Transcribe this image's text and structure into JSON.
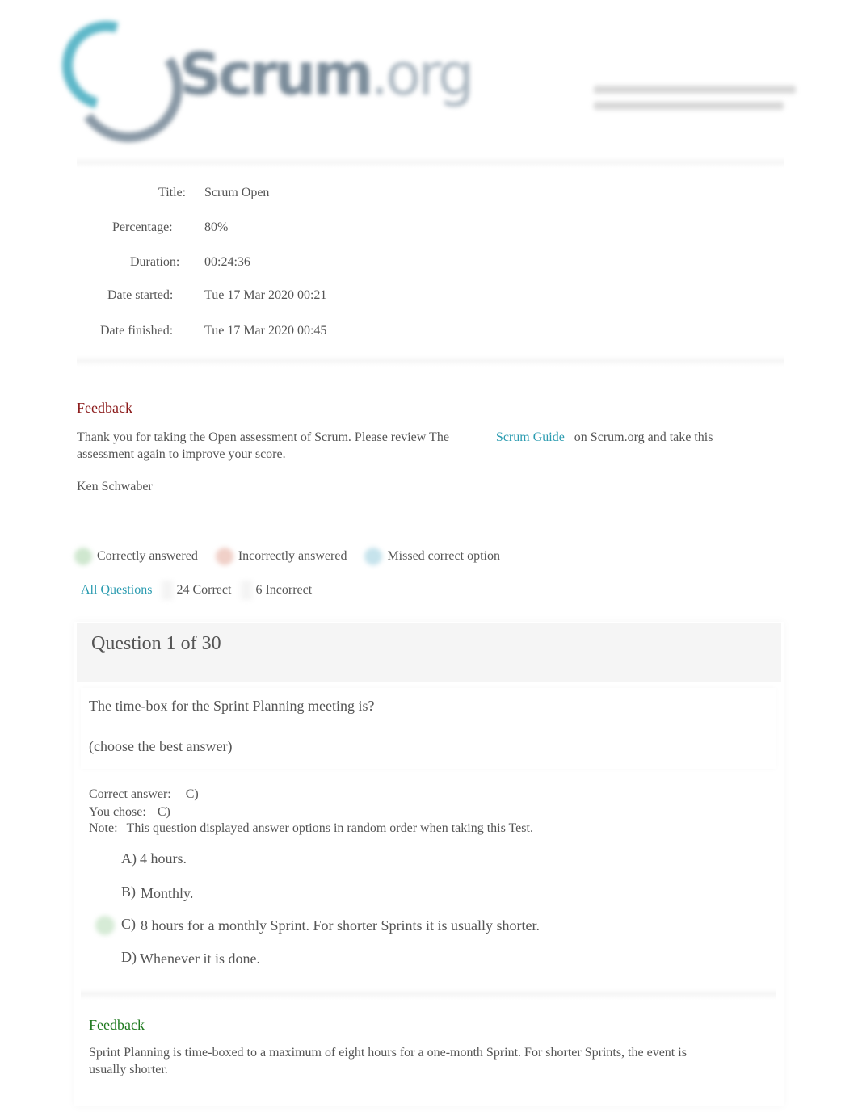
{
  "header": {
    "logo_text_main": "Scrum",
    "logo_text_suffix": ".org"
  },
  "result": {
    "fields": [
      {
        "label": "Title:",
        "value": "Scrum Open"
      },
      {
        "label": "Percentage:",
        "value": "80%"
      },
      {
        "label": "Duration:",
        "value": "00:24:36"
      },
      {
        "label": "Date started:",
        "value": "Tue 17 Mar 2020 00:21"
      },
      {
        "label": "Date finished:",
        "value": "Tue 17 Mar 2020 00:45"
      }
    ]
  },
  "feedback": {
    "title": "Feedback",
    "text_before": "Thank you for taking the Open assessment of Scrum. Please review The",
    "link": "Scrum Guide",
    "text_after": "on Scrum.org and take this assessment again to improve your score.",
    "signature": "Ken Schwaber"
  },
  "legend": {
    "correct": "Correctly answered",
    "incorrect": "Incorrectly answered",
    "missed": "Missed correct option"
  },
  "filters": {
    "all": "All Questions",
    "correct_count": "24",
    "correct_label": "Correct",
    "incorrect_count": "6",
    "incorrect_label": "Incorrect"
  },
  "question": {
    "header": "Question 1 of 30",
    "text": "The time-box for the Sprint Planning meeting is?",
    "hint": "(choose the best answer)",
    "correct_answer_label": "Correct answer:",
    "correct_answer_value": "C)",
    "you_chose_label": "You chose:",
    "you_chose_value": "C)",
    "note_label": "Note:",
    "note_text": "This question displayed answer options in random order when taking this Test.",
    "options": [
      {
        "letter": "A)",
        "text": "4 hours.",
        "status": "none"
      },
      {
        "letter": "B)",
        "text": "Monthly.",
        "status": "none"
      },
      {
        "letter": "C)",
        "text": "8 hours for a monthly Sprint. For shorter Sprints it is usually shorter.",
        "status": "correct"
      },
      {
        "letter": "D)",
        "text": "Whenever it is done.",
        "status": "none"
      }
    ],
    "feedback_title": "Feedback",
    "feedback_text": "Sprint Planning is time-boxed to a maximum of eight hours for a one-month Sprint. For shorter Sprints, the event is usually shorter."
  },
  "colors": {
    "feedback_heading": "#8b1a1a",
    "question_feedback_heading": "#1f7a1f",
    "link": "#2a9bb0",
    "correct": "#cfe7cf",
    "incorrect": "#f0d0c8",
    "missed": "#c6e3ec"
  }
}
